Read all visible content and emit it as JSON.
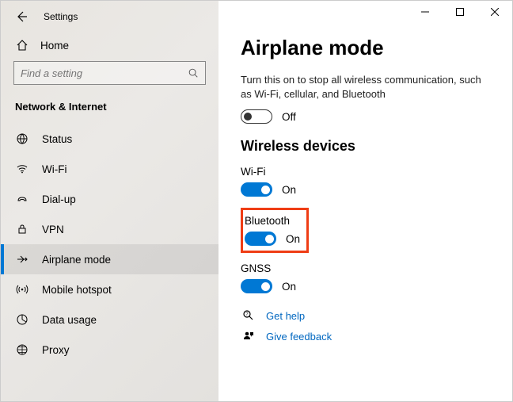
{
  "app_title": "Settings",
  "home_label": "Home",
  "search_placeholder": "Find a setting",
  "section_title": "Network & Internet",
  "nav": [
    {
      "label": "Status"
    },
    {
      "label": "Wi-Fi"
    },
    {
      "label": "Dial-up"
    },
    {
      "label": "VPN"
    },
    {
      "label": "Airplane mode"
    },
    {
      "label": "Mobile hotspot"
    },
    {
      "label": "Data usage"
    },
    {
      "label": "Proxy"
    }
  ],
  "page": {
    "title": "Airplane mode",
    "description": "Turn this on to stop all wireless communication, such as Wi-Fi, cellular, and Bluetooth",
    "main_toggle_label": "Off",
    "wireless_heading": "Wireless devices",
    "devices": {
      "wifi": {
        "name": "Wi-Fi",
        "state": "On"
      },
      "bluetooth": {
        "name": "Bluetooth",
        "state": "On"
      },
      "gnss": {
        "name": "GNSS",
        "state": "On"
      }
    },
    "help_link": "Get help",
    "feedback_link": "Give feedback"
  }
}
